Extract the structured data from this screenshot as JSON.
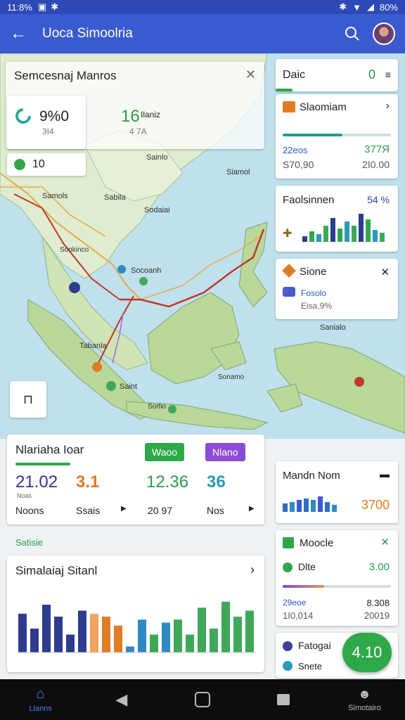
{
  "status_bar": {
    "time": "11:8%",
    "battery": "80%"
  },
  "app_bar": {
    "title": "Uoca Simoolria"
  },
  "map_overlay": {
    "title": "Semcesnaj Manros",
    "stat1_value": "9%0",
    "stat1_sub": "3Ι4",
    "stat2_value": "16",
    "stat2_unit": "Ilaniz",
    "stat2_sub": "4 7A",
    "badge_value": "10"
  },
  "map_labels": [
    "Samols",
    "Sainlo",
    "Siamol",
    "Sabila",
    "Sodaiai",
    "Socoanh",
    "Tabanla",
    "Saint",
    "Sanialo",
    "Sorfio",
    "Sonkinco",
    "Sonamo"
  ],
  "right_cards": {
    "card1": {
      "title": "Daic",
      "value": "0"
    },
    "card2": {
      "title": "Slaomiam",
      "left_top": "22eos",
      "left_bottom": "S70,90",
      "right_top": "377Я",
      "right_bottom": "2Ι0.00"
    },
    "card3": {
      "title": "Faolsinnen",
      "value": "54 %",
      "bars": [
        0.2,
        0.35,
        0.25,
        0.55,
        0.8,
        0.45,
        0.7,
        0.55,
        0.95,
        0.75,
        0.4,
        0.3
      ]
    },
    "card4": {
      "title": "Sione",
      "line1": "Fosolo",
      "line2": "Eisa,9%"
    },
    "card5": {
      "title": "Mandn Nom",
      "value": "3700",
      "bars": [
        0.5,
        0.6,
        0.7,
        0.8,
        0.7,
        0.9,
        0.6,
        0.4
      ]
    },
    "card6": {
      "title": "Moocle",
      "row_label": "Dlte",
      "row_value": "3.00",
      "left_top": "29eoe",
      "left_bottom": "1Ι0,014",
      "right_top": "8.308",
      "right_bottom": "20019"
    },
    "card7": {
      "title": "Fatogai",
      "sub": "Snete"
    }
  },
  "stats_card": {
    "title": "Nlariaha Ioar",
    "pill1": "Waoo",
    "pill2": "Nlano",
    "val1": "21.02",
    "val1_sub": "Noas",
    "val2": "3.1",
    "val3": "12.36",
    "val3_sub": "20 97",
    "val4": "36",
    "row_label1": "Noons",
    "row_label2": "Ssais",
    "row_label3": "Nos"
  },
  "section_label": "Satisie",
  "chart_card": {
    "title": "Simalaiaj Sitanl",
    "chart_data": {
      "type": "bar",
      "values": [
        0.65,
        0.4,
        0.8,
        0.6,
        0.3,
        0.7,
        0.65,
        0.6,
        0.45,
        0.1,
        0.55,
        0.3,
        0.5,
        0.55,
        0.3,
        0.75,
        0.4,
        0.85,
        0.6,
        0.7
      ],
      "colors": [
        "#2e3c8f",
        "#2e3c8f",
        "#2e3c8f",
        "#2e3c8f",
        "#2e3c8f",
        "#2e3c8f",
        "#f2a35c",
        "#e07b26",
        "#e07b26",
        "#2e8ac0",
        "#2e8ac0",
        "#3ea858",
        "#2e8ac0",
        "#3ea858",
        "#3ea858",
        "#3ea858",
        "#3ea858",
        "#3ea858",
        "#3ea858",
        "#3ea858"
      ]
    }
  },
  "fab_label": "4.10",
  "bottom_nav": {
    "item1": "Llanns",
    "item5": "Simotairo"
  },
  "colors": {
    "primary": "#3a5bd0",
    "green": "#2fa84a",
    "purple": "#8c4bd6",
    "orange": "#e07b26"
  }
}
